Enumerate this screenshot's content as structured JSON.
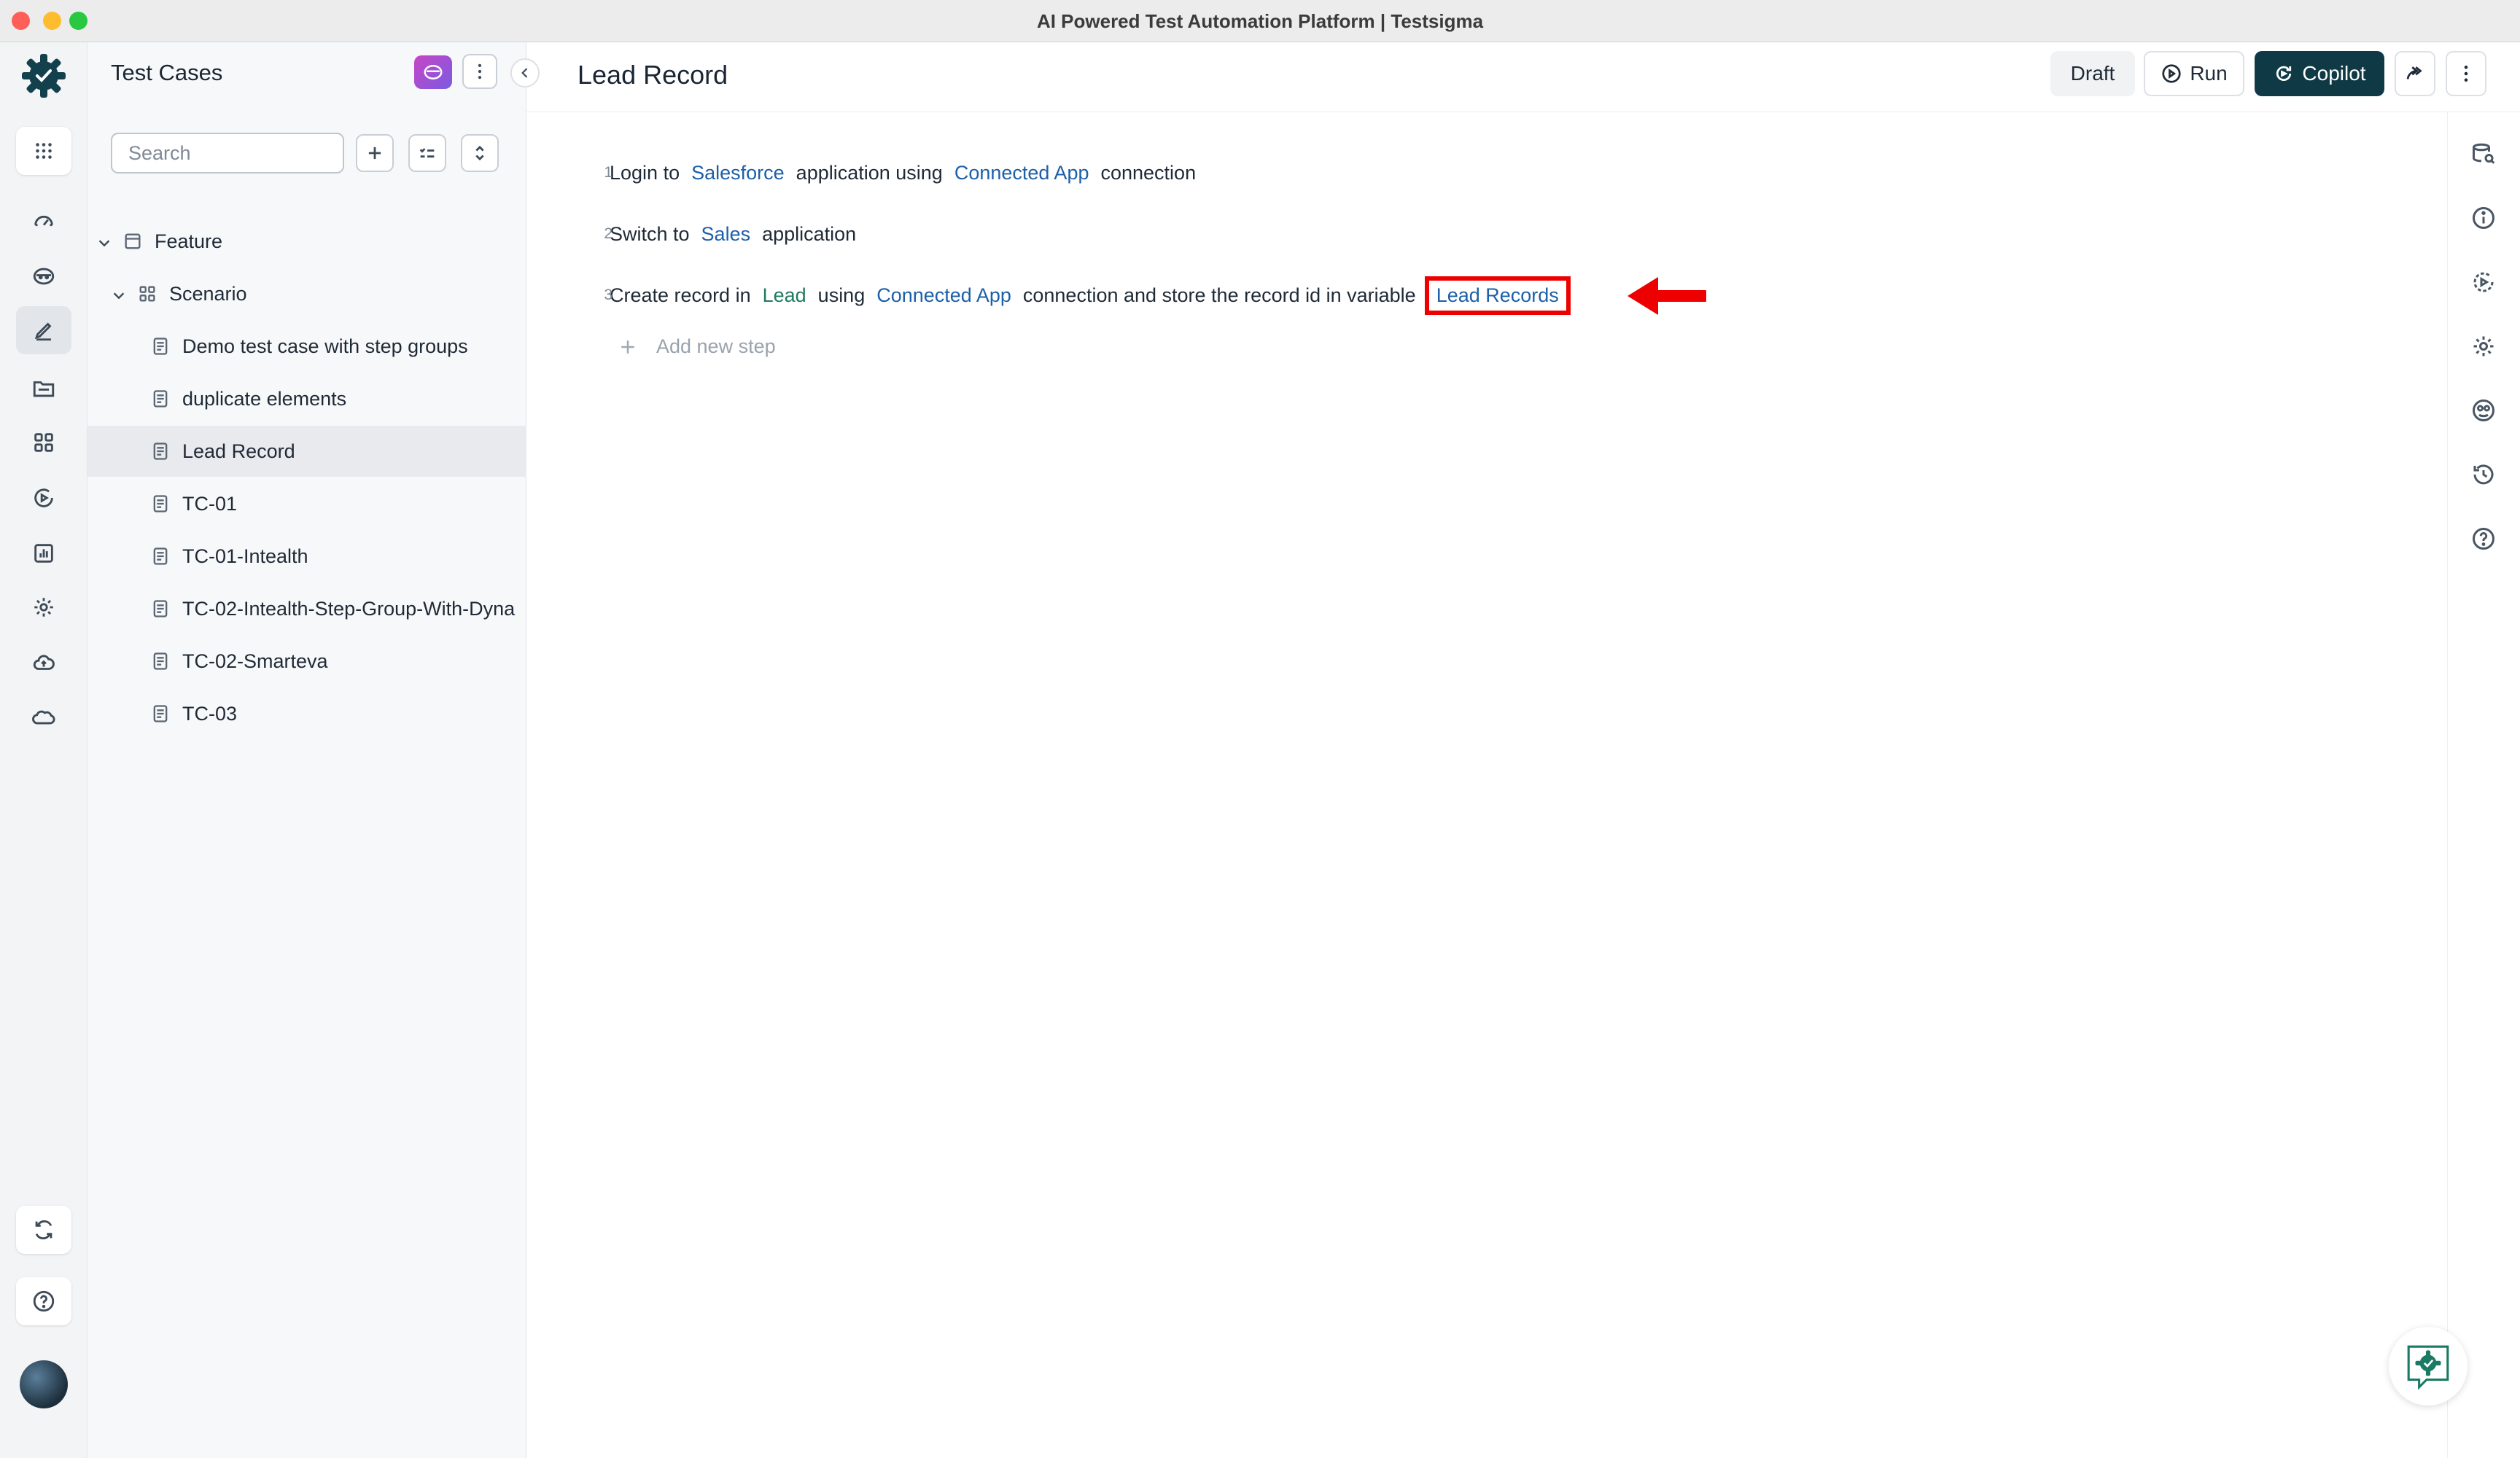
{
  "window": {
    "title": "AI Powered Test Automation Platform | Testsigma"
  },
  "nav_rail": {
    "icons": [
      "app-grid-icon",
      "dashboard-icon",
      "ai-agent-icon",
      "test-cases-icon",
      "test-data-icon",
      "elements-icon",
      "run-results-icon",
      "reports-icon",
      "settings-icon",
      "cloud-upload-icon",
      "salesforce-cloud-icon",
      "sync-icon",
      "help-icon"
    ],
    "active": "test-cases-icon"
  },
  "panel": {
    "title": "Test Cases",
    "search": {
      "placeholder": "Search",
      "value": ""
    },
    "tree": {
      "feature": {
        "label": "Feature"
      },
      "scenario": {
        "label": "Scenario"
      },
      "test_cases": [
        {
          "label": "Demo test case with step groups"
        },
        {
          "label": "duplicate elements"
        },
        {
          "label": "Lead Record",
          "selected": true
        },
        {
          "label": "TC-01"
        },
        {
          "label": "TC-01-Intealth"
        },
        {
          "label": "TC-02-Intealth-Step-Group-With-Dyna"
        },
        {
          "label": "TC-02-Smarteva"
        },
        {
          "label": "TC-03"
        }
      ]
    }
  },
  "main": {
    "title": "Lead Record",
    "buttons": {
      "draft": "Draft",
      "run": "Run",
      "copilot": "Copilot"
    },
    "steps": [
      {
        "num": "1",
        "tokens": [
          {
            "text": "Login to",
            "kind": "text"
          },
          {
            "text": "Salesforce",
            "kind": "var"
          },
          {
            "text": "application using",
            "kind": "text"
          },
          {
            "text": "Connected App",
            "kind": "var"
          },
          {
            "text": "connection",
            "kind": "text"
          }
        ]
      },
      {
        "num": "2",
        "tokens": [
          {
            "text": "Switch to",
            "kind": "text"
          },
          {
            "text": "Sales",
            "kind": "var"
          },
          {
            "text": "application",
            "kind": "text"
          }
        ]
      },
      {
        "num": "3",
        "tokens": [
          {
            "text": "Create record in",
            "kind": "text"
          },
          {
            "text": "Lead",
            "kind": "ent"
          },
          {
            "text": "using",
            "kind": "text"
          },
          {
            "text": "Connected App",
            "kind": "var"
          },
          {
            "text": "connection and store the record id in variable",
            "kind": "text"
          },
          {
            "text": "Lead Records",
            "kind": "var",
            "highlighted": true
          }
        ]
      }
    ],
    "add_step": "Add new step"
  },
  "right_rail": {
    "icons": [
      "test-data-search-icon",
      "info-icon",
      "dry-run-icon",
      "settings-icon",
      "visual-icon",
      "history-icon",
      "help-icon"
    ]
  },
  "colors": {
    "accent": "#0f3a45",
    "variable": "#1d5fa8",
    "entity": "#1f7a60",
    "annotation": "#ee0000"
  }
}
